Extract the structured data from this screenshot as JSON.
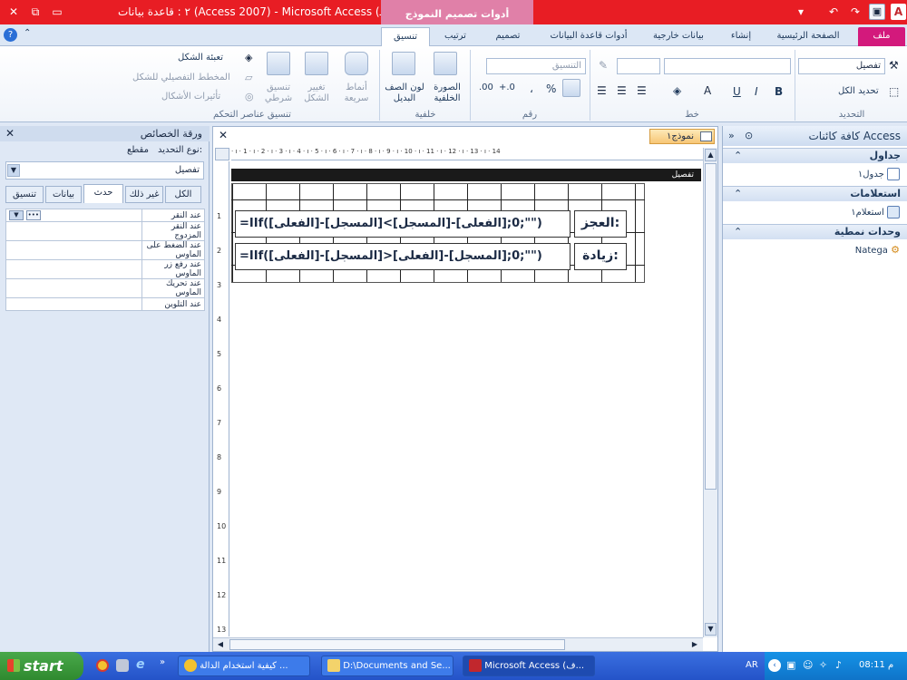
{
  "titlebar": {
    "window_title": "٢ : قاعدة بيانات (Access 2007) - Microsoft Access (قشـ...",
    "context_tab": "أدوات تصميم النموذج"
  },
  "tabs": {
    "file": "ملف",
    "home": "الصفحة الرئيسية",
    "create": "إنشاء",
    "external": "بيانات خارجية",
    "dbtools": "أدوات قاعدة البيانات",
    "design": "تصميم",
    "arrange": "ترتيب",
    "format": "تنسيق"
  },
  "ribbon": {
    "selection": {
      "combo": "تفصيل",
      "select_all": "تحديد الكل",
      "group": "التحديد"
    },
    "font": {
      "group": "خط",
      "bold": "B",
      "italic": "I",
      "underline": "U"
    },
    "number": {
      "format_combo": "التنسيق",
      "group": "رقم",
      "percent": "%",
      "comma": "،"
    },
    "background": {
      "bg_image": "الصورة الخلفية",
      "alt_row": "لون الصف البديل",
      "group": "خلفية"
    },
    "control_format": {
      "quick_styles": "أنماط سريعة",
      "change_shape": "تغيير الشكل",
      "conditional": "تنسيق شرطي",
      "shape_fill": "تعبئة الشكل",
      "shape_outline": "المخطط التفصيلي للشكل",
      "shape_effects": "تأثيرات الأشكال",
      "group": "تنسيق عناصر التحكم"
    }
  },
  "property_sheet": {
    "title": "ورقة الخصائص",
    "selection_type_label": "نوع التحديد:",
    "selection_type_value": "مقطع",
    "selected_object": "تفصيل",
    "tabs": [
      "تنسيق",
      "بيانات",
      "حدث",
      "غير ذلك",
      "الكل"
    ],
    "active_tab": "حدث",
    "rows": [
      "عند النقر",
      "عند النقر المزدوج",
      "عند الضغط على الماوس",
      "عند رفع زر الماوس",
      "عند تحريك الماوس",
      "عند التلوين"
    ]
  },
  "designer": {
    "doc_tab": "نموذج١",
    "section": "تفصيل",
    "label1": "العجز:",
    "expr1": "=IIf([الفعلى]-[المسجل]<0;[الفعلى]-[المسجل];\"\")",
    "label2": "زيادة:",
    "expr2": "=IIf([الفعلى]-[المسجل]>0;[المسجل]-[الفعلى];\"\")",
    "ruler_top": "· ı · 1 · ı · 2 · ı · 3 · ı · 4 · ı · 5 · ı · 6 · ı · 7 · ı · 8 · ı · 9 · ı · 10 · ı · 11 · ı · 12 · ı · 13 · ı · 14",
    "ruler_left": [
      "1",
      "2",
      "3",
      "4",
      "5",
      "6",
      "7",
      "8",
      "9",
      "10",
      "11",
      "12",
      "13"
    ]
  },
  "nav_pane": {
    "title": "كافة كائنات Access",
    "categories": [
      {
        "name": "جداول",
        "items": [
          "جدول١"
        ]
      },
      {
        "name": "استعلامات",
        "items": [
          "استعلام١"
        ]
      },
      {
        "name": "وحدات نمطية",
        "items": [
          "Natega"
        ]
      }
    ]
  },
  "taskbar": {
    "start": "start",
    "buttons": [
      "كيفية استخدام الدالة ...",
      "D:\\Documents and Se...",
      "Microsoft Access (ف..."
    ],
    "lang": "AR",
    "clock": "08:11 م"
  },
  "colors": {
    "titlebar": "#e81d24",
    "file_tab": "#d3197c",
    "context_tab": "#e080a8",
    "taskbar": "#2453c8",
    "start": "#2f8a2f"
  }
}
